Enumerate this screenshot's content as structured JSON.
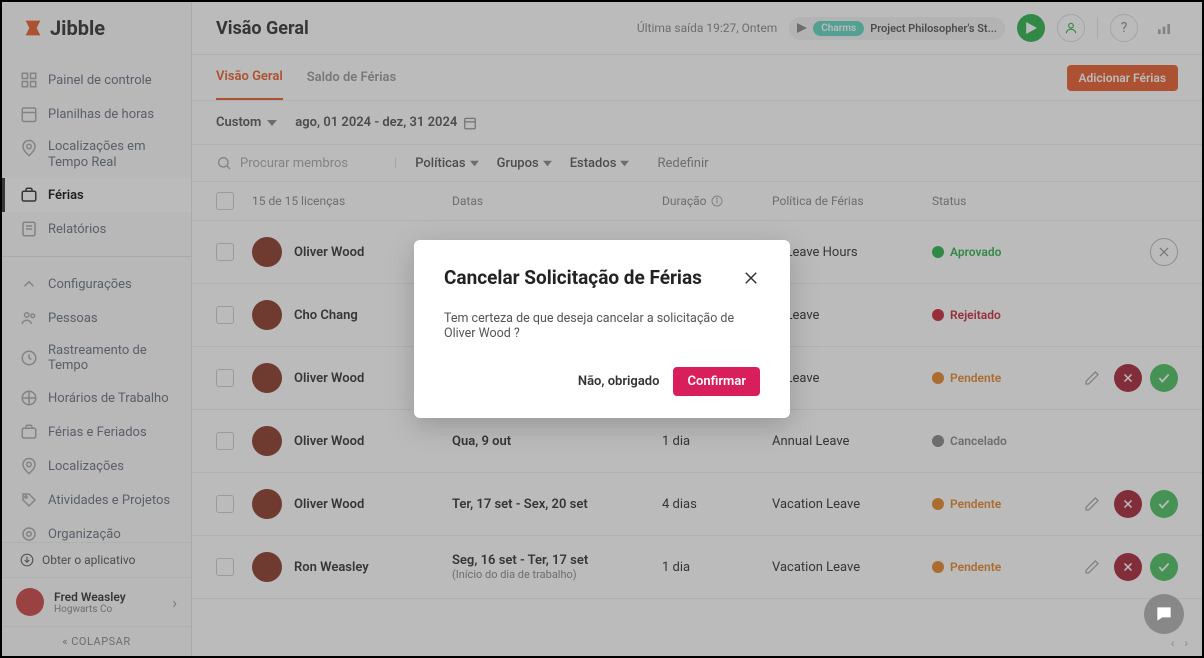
{
  "logo": {
    "text": "Jibble"
  },
  "sidebar": {
    "items": [
      {
        "label": "Painel de controle"
      },
      {
        "label": "Planilhas de horas"
      },
      {
        "label": "Localizações em Tempo Real"
      },
      {
        "label": "Férias"
      },
      {
        "label": "Relatórios"
      },
      {
        "label": "Configurações"
      },
      {
        "label": "Pessoas"
      },
      {
        "label": "Rastreamento de Tempo"
      },
      {
        "label": "Horários de Trabalho"
      },
      {
        "label": "Férias e Feriados"
      },
      {
        "label": "Localizações"
      },
      {
        "label": "Atividades e Projetos"
      },
      {
        "label": "Organização"
      }
    ],
    "get_app": "Obter o aplicativo",
    "user": {
      "name": "Fred Weasley",
      "org": "Hogwarts Co"
    },
    "collapse": "COLAPSAR"
  },
  "topbar": {
    "title": "Visão Geral",
    "last_exit": "Última saída 19:27, Ontem",
    "badge": "Charms",
    "project": "Project Philosopher's St..."
  },
  "tabs": {
    "overview": "Visão Geral",
    "balance": "Saldo de Férias",
    "add": "Adicionar Férias"
  },
  "filters": {
    "range_label": "Custom",
    "range_value": "ago, 01 2024 - dez, 31 2024"
  },
  "search": {
    "placeholder": "Procurar membros",
    "policies": "Políticas",
    "groups": "Grupos",
    "states": "Estados",
    "reset": "Redefinir"
  },
  "table": {
    "count": "15 de 15 licenças",
    "headers": {
      "dates": "Datas",
      "duration": "Duração",
      "policy": "Política de Férias",
      "status": "Status"
    },
    "rows": [
      {
        "member": "Oliver Wood",
        "dates": "",
        "sub": "",
        "duration": "",
        "policy": "al Leave Hours",
        "status": "Aprovado",
        "status_class": "approved",
        "actions": "cancel"
      },
      {
        "member": "Cho Chang",
        "dates": "",
        "sub": "",
        "duration": "",
        "policy": "al Leave",
        "status": "Rejeitado",
        "status_class": "rejected",
        "actions": ""
      },
      {
        "member": "Oliver Wood",
        "dates": "",
        "sub": "",
        "duration": "",
        "policy": "al Leave",
        "status": "Pendente",
        "status_class": "pending",
        "actions": "full"
      },
      {
        "member": "Oliver Wood",
        "dates": "Qua, 9 out",
        "sub": "",
        "duration": "1 dia",
        "policy": "Annual Leave",
        "status": "Cancelado",
        "status_class": "cancelled",
        "actions": ""
      },
      {
        "member": "Oliver Wood",
        "dates": "Ter, 17 set - Sex, 20 set",
        "sub": "",
        "duration": "4 dias",
        "policy": "Vacation Leave",
        "status": "Pendente",
        "status_class": "pending",
        "actions": "full"
      },
      {
        "member": "Ron Weasley",
        "dates": "Seg, 16 set - Ter, 17 set",
        "sub": "(Início do dia de trabalho)",
        "duration": "1 dia",
        "policy": "Vacation Leave",
        "status": "Pendente",
        "status_class": "pending",
        "actions": "full"
      }
    ]
  },
  "modal": {
    "title": "Cancelar Solicitação de Férias",
    "body": "Tem certeza de que deseja cancelar a solicitação de Oliver Wood ?",
    "no": "Não, obrigado",
    "confirm": "Confirmar"
  }
}
